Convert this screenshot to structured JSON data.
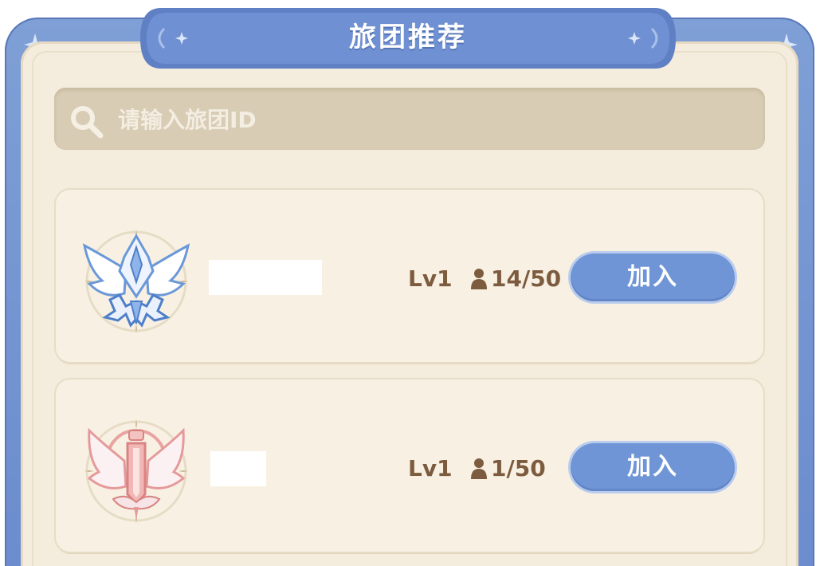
{
  "header": {
    "title": "旅团推荐"
  },
  "search": {
    "placeholder": "请输入旅团ID",
    "value": ""
  },
  "guilds": [
    {
      "emblem": "blue-winged-star-emblem-icon",
      "name": "",
      "level": "Lv1",
      "members": "14/50",
      "join_label": "加入"
    },
    {
      "emblem": "pink-winged-sword-emblem-icon",
      "name": "",
      "level": "Lv1",
      "members": "1/50",
      "join_label": "加入"
    }
  ],
  "colors": {
    "frame": "#6b8ccd",
    "panel": "#f4ecdc",
    "card": "#f8f1e3",
    "search_bg": "#d8ccb4",
    "button": "#6f95d6",
    "text_brown": "#7d5b3f"
  }
}
